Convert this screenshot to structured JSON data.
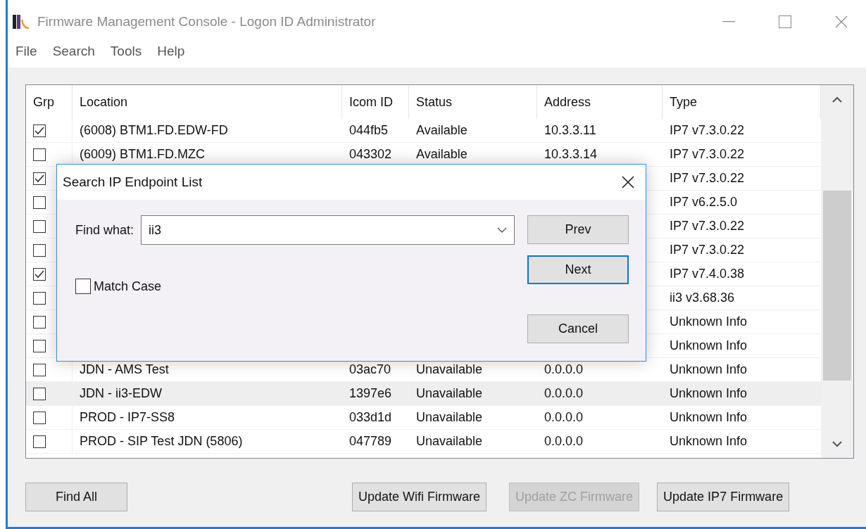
{
  "window": {
    "title": "Firmware Management Console - Logon ID Administrator"
  },
  "menu": [
    "File",
    "Search",
    "Tools",
    "Help"
  ],
  "table": {
    "columns": [
      "Grp",
      "Location",
      "Icom ID",
      "Status",
      "Address",
      "Type"
    ],
    "rows": [
      {
        "checked": true,
        "hovered": false,
        "location": "(6008) BTM1.FD.EDW-FD",
        "icom_id": "044fb5",
        "status": "Available",
        "address": "10.3.3.11",
        "type": "IP7 v7.3.0.22"
      },
      {
        "checked": false,
        "hovered": false,
        "location": "(6009) BTM1.FD.MZC",
        "icom_id": "043302",
        "status": "Available",
        "address": "10.3.3.14",
        "type": "IP7 v7.3.0.22"
      },
      {
        "checked": true,
        "hovered": false,
        "type": "IP7 v7.3.0.22"
      },
      {
        "checked": false,
        "hovered": false,
        "type": "IP7 v6.2.5.0"
      },
      {
        "checked": false,
        "hovered": false,
        "type": "IP7 v7.3.0.22"
      },
      {
        "checked": false,
        "hovered": false,
        "type": "IP7 v7.3.0.22"
      },
      {
        "checked": true,
        "hovered": false,
        "type": "IP7 v7.4.0.38"
      },
      {
        "checked": false,
        "hovered": false,
        "type": "ii3 v3.68.36"
      },
      {
        "checked": false,
        "hovered": false,
        "type": "Unknown Info"
      },
      {
        "checked": false,
        "hovered": false,
        "type": "Unknown Info"
      },
      {
        "checked": false,
        "hovered": false,
        "location": "JDN - AMS Test",
        "icom_id": "03ac70",
        "status": "Unavailable",
        "address": "0.0.0.0",
        "type": "Unknown Info"
      },
      {
        "checked": false,
        "hovered": true,
        "location": "JDN - ii3-EDW",
        "icom_id": "1397e6",
        "status": "Unavailable",
        "address": "0.0.0.0",
        "type": "Unknown Info"
      },
      {
        "checked": false,
        "hovered": false,
        "location": "PROD - IP7-SS8",
        "icom_id": "033d1d",
        "status": "Unavailable",
        "address": "0.0.0.0",
        "type": "Unknown Info"
      },
      {
        "checked": false,
        "hovered": false,
        "location": "PROD - SIP Test JDN (5806)",
        "icom_id": "047789",
        "status": "Unavailable",
        "address": "0.0.0.0",
        "type": "Unknown Info"
      }
    ]
  },
  "buttons": [
    {
      "label": "Find All",
      "disabled": false
    },
    {
      "label": "Update Wifi Firmware",
      "disabled": false
    },
    {
      "label": "Update ZC Firmware",
      "disabled": true
    },
    {
      "label": "Update IP7 Firmware",
      "disabled": false
    }
  ],
  "dialog": {
    "title": "Search IP Endpoint List",
    "find_label": "Find what:",
    "find_value": "ii3",
    "match_case": {
      "label": "Match Case",
      "checked": false
    },
    "buttons": [
      {
        "label": "Prev",
        "selected": false
      },
      {
        "label": "Next",
        "selected": true
      },
      {
        "label": "Cancel",
        "selected": false
      }
    ]
  }
}
